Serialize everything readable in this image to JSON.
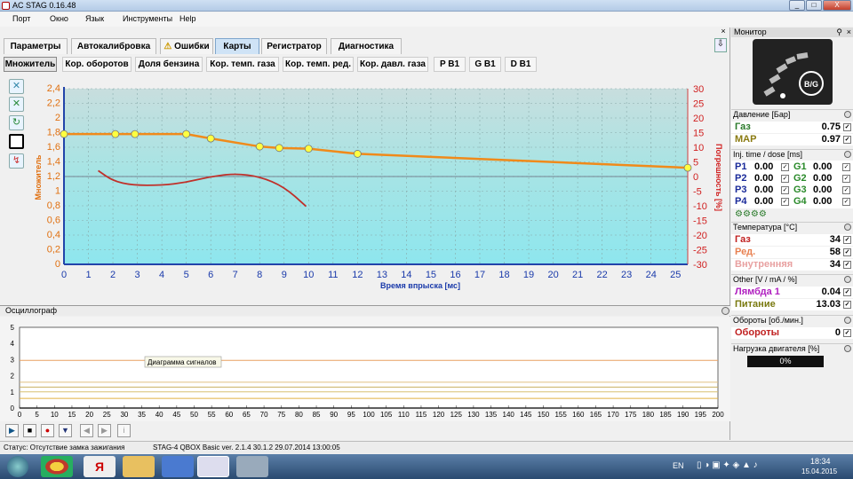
{
  "window": {
    "title": "AC STAG 0.16.48",
    "min": "_",
    "max": "□",
    "close": "X"
  },
  "menu": [
    "Порт",
    "Окно",
    "Язык",
    "Инструменты",
    "Help"
  ],
  "tabs": [
    "Параметры",
    "Автокалибровка",
    "Ошибки",
    "Карты",
    "Регистратор",
    "Диагностика"
  ],
  "active_tab": "Карты",
  "subtabs": [
    "Множитель",
    "Кор. оборотов",
    "Доля бензина",
    "Кор. темп. газа",
    "Кор. темп. ред.",
    "Кор. давл. газа",
    "P B1",
    "G B1",
    "D B1"
  ],
  "chart_data": {
    "type": "line",
    "xlabel": "Время впрыска [мс]",
    "ylabel_left": "Множитель",
    "ylabel_right": "Погрешность [%]",
    "x_ticks": [
      0,
      1,
      2,
      3,
      4,
      5,
      6,
      7,
      8,
      9,
      10,
      11,
      12,
      13,
      14,
      15,
      16,
      17,
      18,
      19,
      20,
      21,
      22,
      23,
      24,
      25
    ],
    "y_left_ticks": [
      "2,4",
      "2,2",
      "2",
      "1,8",
      "1,6",
      "1,4",
      "1,2",
      "1",
      "0,8",
      "0,6",
      "0,4",
      "0,2",
      "0"
    ],
    "y_right_ticks": [
      "30",
      "25",
      "20",
      "15",
      "10",
      "5",
      "0",
      "-5",
      "-10",
      "-15",
      "-20",
      "-25",
      "-30"
    ],
    "xlim": [
      0,
      25.5
    ],
    "ylim_left": [
      0,
      2.4
    ],
    "ylim_right": [
      -30,
      30
    ],
    "series": [
      {
        "color": "#f08a1a",
        "axis": "left",
        "markers": true,
        "points": [
          [
            0,
            1.78
          ],
          [
            2.1,
            1.78
          ],
          [
            2.9,
            1.78
          ],
          [
            5,
            1.78
          ],
          [
            6,
            1.72
          ],
          [
            8,
            1.61
          ],
          [
            8.8,
            1.59
          ],
          [
            10,
            1.58
          ],
          [
            12,
            1.51
          ],
          [
            25.5,
            1.32
          ]
        ]
      },
      {
        "color": "#c0302a",
        "axis": "right",
        "points": [
          [
            1.4,
            2
          ],
          [
            2,
            -1.5
          ],
          [
            2.8,
            -3
          ],
          [
            4,
            -3
          ],
          [
            5,
            -2
          ],
          [
            6,
            0
          ],
          [
            7,
            1
          ],
          [
            8,
            0
          ],
          [
            9,
            -3.5
          ],
          [
            9.9,
            -10.2
          ]
        ]
      }
    ]
  },
  "osc": {
    "title": "Осциллограф",
    "label": "Диаграмма сигналов",
    "y_ticks": [
      "5",
      "4",
      "3",
      "2",
      "1",
      "0"
    ],
    "x_ticks": [
      "0",
      "5",
      "10",
      "15",
      "20",
      "25",
      "30",
      "35",
      "40",
      "45",
      "50",
      "55",
      "60",
      "65",
      "70",
      "75",
      "80",
      "85",
      "90",
      "95",
      "100",
      "105",
      "110",
      "115",
      "120",
      "125",
      "130",
      "135",
      "140",
      "145",
      "150",
      "155",
      "160",
      "165",
      "170",
      "175",
      "180",
      "185",
      "190",
      "195",
      "200"
    ],
    "lines": [
      {
        "y": 2.95,
        "color": "#e8a060"
      },
      {
        "y": 1.6,
        "color": "#e0c080"
      },
      {
        "y": 1.3,
        "color": "#c8b060"
      },
      {
        "y": 1.0,
        "color": "#d8c070"
      },
      {
        "y": 0.6,
        "color": "#e0b040"
      }
    ],
    "buttons": [
      "▶",
      "■",
      "●",
      "▼",
      "◀",
      "▶",
      "i"
    ]
  },
  "status": {
    "text": "Статус: Отсутствие замка зажигания",
    "device": "STAG-4 QBOX Basic  ver. 2.1.4  30.1.2  29.07.2014 13:00:05"
  },
  "monitor": {
    "title": "Монитор",
    "logo": "B/G",
    "pressure_head": "Давление [Бар]",
    "gas_label": "Газ",
    "gas_val": "0.75",
    "map_label": "MAP",
    "map_val": "0.97",
    "inj_head": "Inj. time / dose [ms]",
    "p": [
      {
        "l": "P1",
        "v": "0.00"
      },
      {
        "l": "P2",
        "v": "0.00"
      },
      {
        "l": "P3",
        "v": "0.00"
      },
      {
        "l": "P4",
        "v": "0.00"
      }
    ],
    "g": [
      {
        "l": "G1",
        "v": "0.00"
      },
      {
        "l": "G2",
        "v": "0.00"
      },
      {
        "l": "G3",
        "v": "0.00"
      },
      {
        "l": "G4",
        "v": "0.00"
      }
    ],
    "temp_head": "Температура [°C]",
    "t_gas_l": "Газ",
    "t_gas_v": "34",
    "t_red_l": "Ред.",
    "t_red_v": "58",
    "t_in_l": "Внутренняя",
    "t_in_v": "34",
    "other_head": "Other [V / mA / %]",
    "lambda_l": "Лямбда 1",
    "lambda_v": "0.04",
    "power_l": "Питание",
    "power_v": "13.03",
    "rpm_head": "Обороты [об./мин.]",
    "rpm_l": "Обороты",
    "rpm_v": "0",
    "load_head": "Нагрузка двигателя [%]",
    "load_v": "0%",
    "load_fraction": 0
  },
  "taskbar": {
    "lang": "EN",
    "time": "18:34",
    "date": "15.04.2015"
  }
}
